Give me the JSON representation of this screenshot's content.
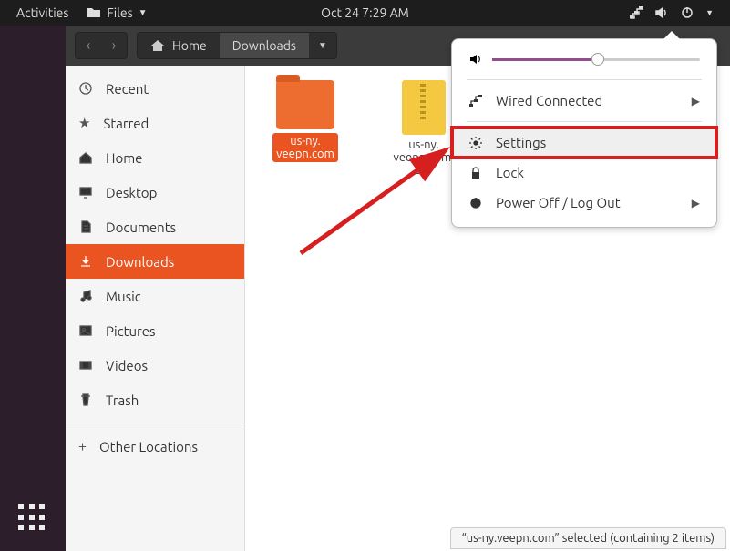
{
  "panel": {
    "activities": "Activities",
    "app_label": "Files",
    "datetime": "Oct 24   7:29 AM"
  },
  "headerbar": {
    "home": "Home",
    "current_folder": "Downloads"
  },
  "sidebar": {
    "items": [
      {
        "label": "Recent"
      },
      {
        "label": "Starred"
      },
      {
        "label": "Home"
      },
      {
        "label": "Desktop"
      },
      {
        "label": "Documents"
      },
      {
        "label": "Downloads"
      },
      {
        "label": "Music"
      },
      {
        "label": "Pictures"
      },
      {
        "label": "Videos"
      },
      {
        "label": "Trash"
      }
    ],
    "other": "Other Locations"
  },
  "files": {
    "folder": "us-ny.\nveepn.com",
    "zip": "us-ny.\nveepn.com.\nzip"
  },
  "statusbar": "“us-ny.veepn.com” selected  (containing 2 items)",
  "sysmenu": {
    "wired": "Wired Connected",
    "settings": "Settings",
    "lock": "Lock",
    "power": "Power Off / Log Out"
  }
}
